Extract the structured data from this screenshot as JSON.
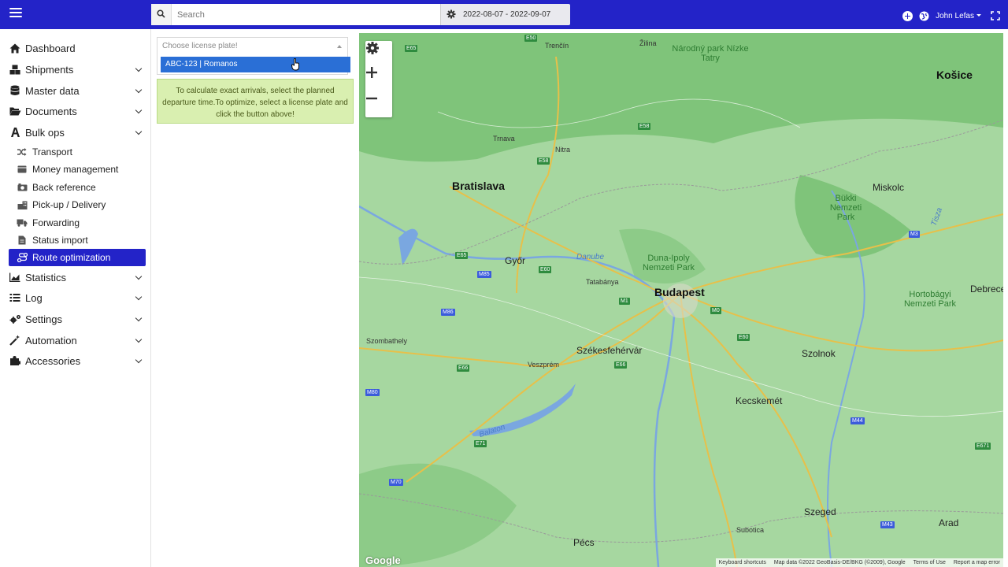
{
  "topbar": {
    "search_placeholder": "Search",
    "date_range": "2022-08-07 - 2022-09-07",
    "user_name": "John Lefas"
  },
  "sidebar": {
    "items": [
      {
        "label": "Dashboard",
        "icon": "home-icon"
      },
      {
        "label": "Shipments",
        "icon": "boxes-icon"
      },
      {
        "label": "Master data",
        "icon": "database-icon"
      },
      {
        "label": "Documents",
        "icon": "folder-icon"
      },
      {
        "label": "Bulk ops",
        "icon": "hand-icon"
      }
    ],
    "sub_items": [
      {
        "label": "Transport",
        "icon": "shuffle-icon"
      },
      {
        "label": "Money management",
        "icon": "wallet-icon"
      },
      {
        "label": "Back reference",
        "icon": "camera-icon"
      },
      {
        "label": "Pick-up / Delivery",
        "icon": "building-icon"
      },
      {
        "label": "Forwarding",
        "icon": "truck-icon"
      },
      {
        "label": "Status import",
        "icon": "file-icon"
      },
      {
        "label": "Route optimization",
        "icon": "route-icon"
      }
    ],
    "items_bottom": [
      {
        "label": "Statistics",
        "icon": "chart-icon"
      },
      {
        "label": "Log",
        "icon": "log-icon"
      },
      {
        "label": "Settings",
        "icon": "cogs-icon"
      },
      {
        "label": "Automation",
        "icon": "magic-icon"
      },
      {
        "label": "Accessories",
        "icon": "puzzle-icon"
      }
    ]
  },
  "panel": {
    "select_placeholder": "Choose license plate!",
    "option": "ABC-123 | Romanos",
    "info_line1": "To calculate exact arrivals, select the planned",
    "info_line2": "departure time.To optimize, select a license plate and",
    "info_line3": "click the button above!"
  },
  "map": {
    "cities_big": [
      "Bratislava",
      "Budapest",
      "Košice"
    ],
    "cities": [
      "Trenčín",
      "Žilina",
      "Nitra",
      "Trnava",
      "Győr",
      "Tatabánya",
      "Székesfehérvár",
      "Veszprém",
      "Kecskemét",
      "Szolnok",
      "Miskolc",
      "Szeged",
      "Szombathely",
      "Debrecen",
      "Pécs",
      "Arad",
      "Subotica"
    ],
    "rivers": [
      "Danube",
      "Balaton",
      "Tisza"
    ],
    "parks": [
      "Bükki Nemzeti Park",
      "Duna-Ipoly Nemzeti Park",
      "Hortobágyi Nemzeti Park",
      "Národný park Nízke Tatry"
    ],
    "footer": [
      "Keyboard shortcuts",
      "Map data ©2022 GeoBasis-DE/BKG (©2009), Google",
      "Terms of Use",
      "Report a map error"
    ],
    "google": "Google"
  }
}
